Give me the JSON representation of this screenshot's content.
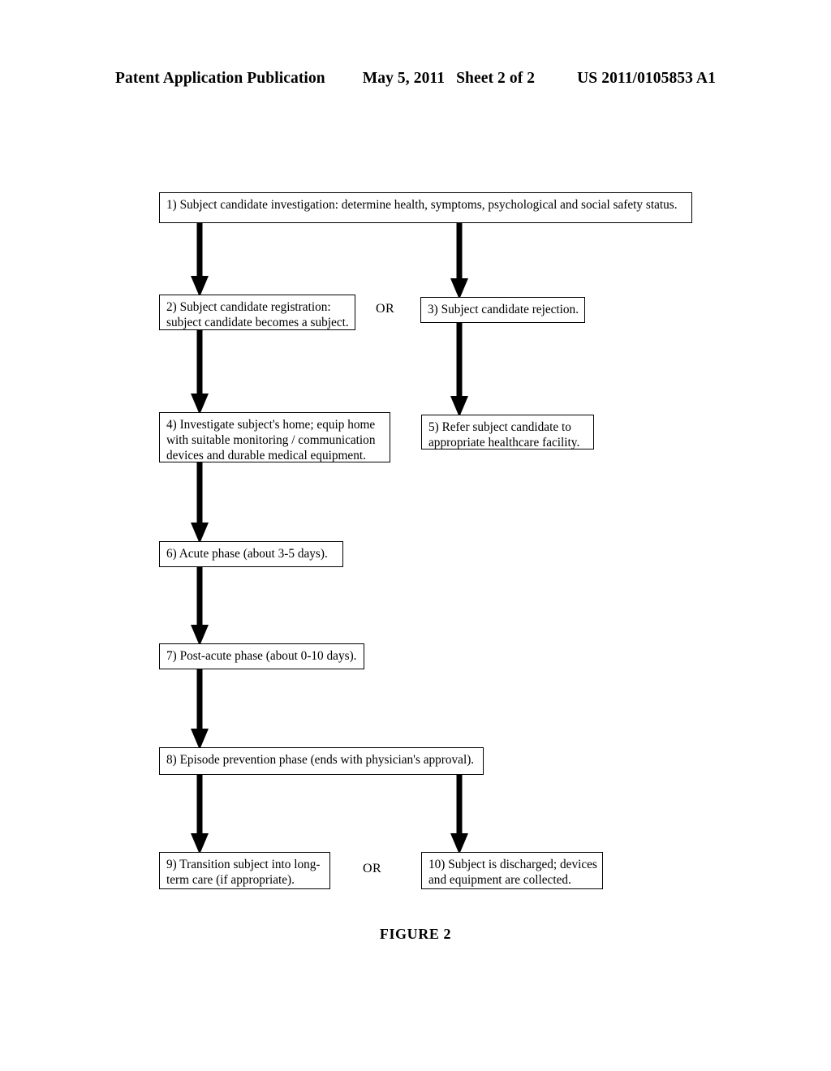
{
  "header": {
    "publication": "Patent Application Publication",
    "date": "May 5, 2011",
    "sheet": "Sheet 2 of 2",
    "patent_number": "US 2011/0105853 A1"
  },
  "figure": {
    "caption": "FIGURE 2"
  },
  "connector_labels": {
    "top_or": "OR",
    "bottom_or": "OR"
  },
  "flowchart": {
    "nodes": [
      {
        "id": 1,
        "text": "1) Subject candidate investigation: determine health, symptoms, psychological and social safety status."
      },
      {
        "id": 2,
        "text": "2) Subject candidate registration: subject candidate becomes a subject."
      },
      {
        "id": 3,
        "text": "3) Subject candidate rejection."
      },
      {
        "id": 4,
        "text": "4) Investigate subject's home; equip home with suitable monitoring / communication devices and durable medical equipment."
      },
      {
        "id": 5,
        "text": "5) Refer subject candidate to appropriate healthcare facility."
      },
      {
        "id": 6,
        "text": "6) Acute phase (about 3-5 days)."
      },
      {
        "id": 7,
        "text": "7) Post-acute phase (about 0-10 days)."
      },
      {
        "id": 8,
        "text": "8) Episode prevention phase (ends with physician's approval)."
      },
      {
        "id": 9,
        "text": "9) Transition subject into long-term care (if appropriate)."
      },
      {
        "id": 10,
        "text": "10) Subject is discharged; devices and equipment are collected."
      }
    ],
    "edges": [
      {
        "from": 1,
        "to": 2
      },
      {
        "from": 1,
        "to": 3
      },
      {
        "from": 2,
        "to": 4
      },
      {
        "from": 3,
        "to": 5
      },
      {
        "from": 4,
        "to": 6
      },
      {
        "from": 6,
        "to": 7
      },
      {
        "from": 7,
        "to": 8
      },
      {
        "from": 8,
        "to": 9
      },
      {
        "from": 8,
        "to": 10
      }
    ]
  }
}
